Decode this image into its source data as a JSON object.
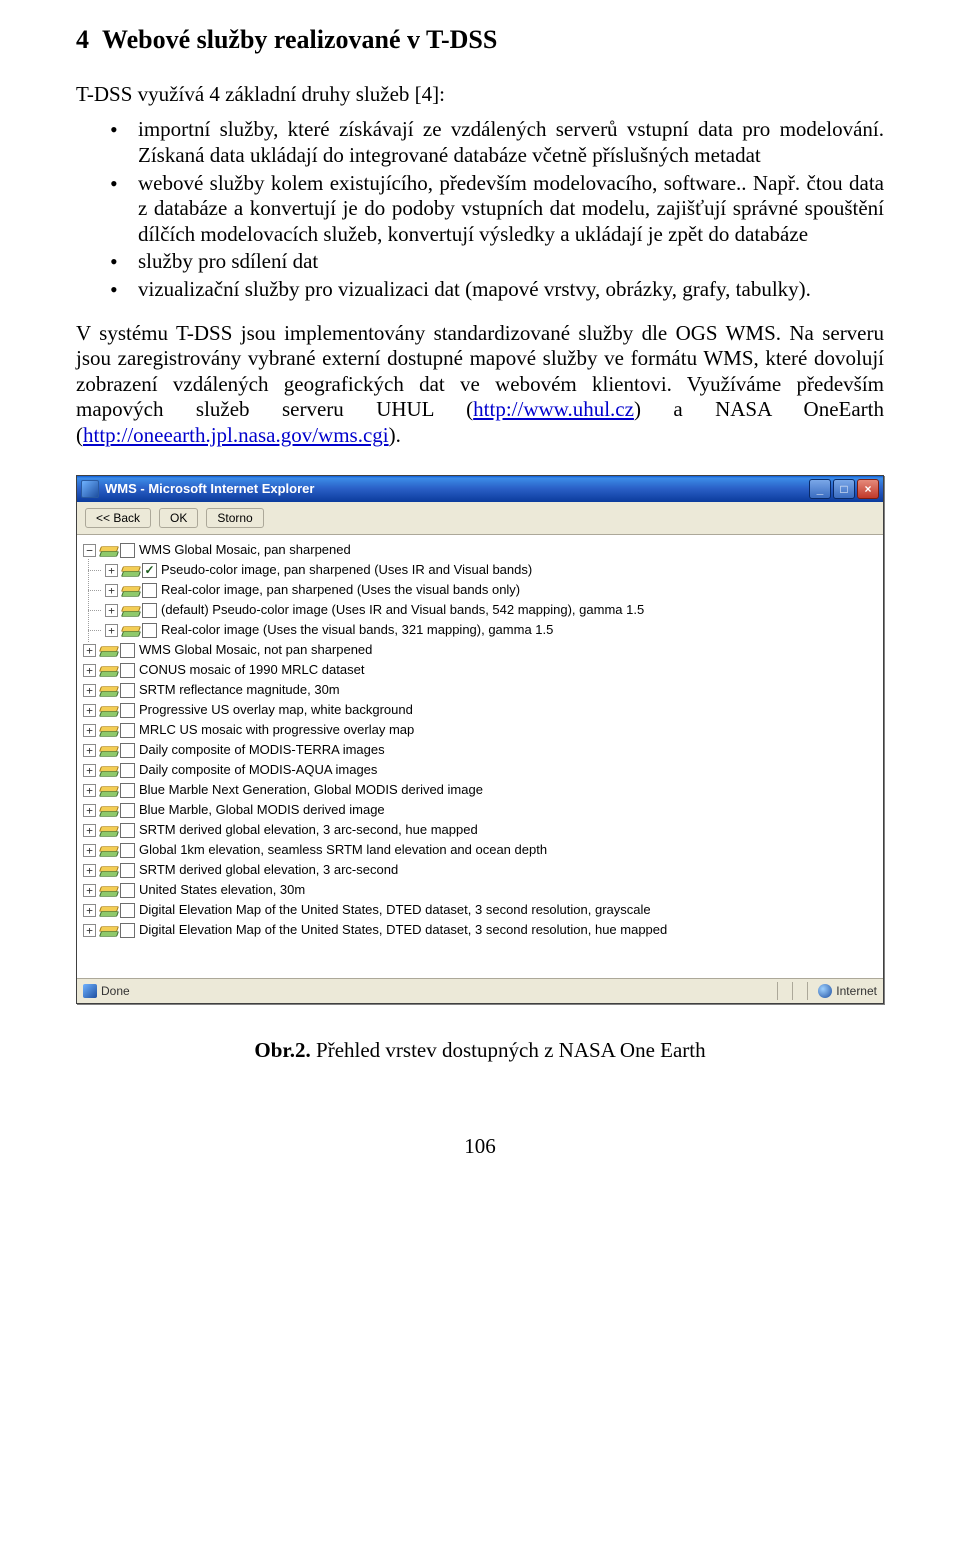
{
  "section": {
    "number": "4",
    "title": "Webové služby realizované v T-DSS"
  },
  "intro": "T-DSS využívá 4 základní druhy služeb [4]:",
  "bullets": [
    "importní služby, které získávají ze vzdálených serverů vstupní data pro modelování. Získaná data ukládají do integrované databáze včetně příslušných metadat",
    "webové služby kolem existujícího, především modelovacího, software.. Např. čtou data z databáze a konvertují je do podoby vstupních dat modelu, zajišťují správné spouštění dílčích modelovacích služeb, konvertují výsledky a ukládají je zpět do databáze",
    "služby pro sdílení dat",
    "vizualizační služby pro vizualizaci dat (mapové vrstvy, obrázky, grafy, tabulky)."
  ],
  "para_parts": {
    "a": "V systému T-DSS jsou implementovány standardizované služby dle OGS WMS. Na serveru jsou zaregistrovány vybrané externí dostupné mapové služby ve formátu WMS, které dovolují zobrazení vzdálených geografických dat ve webovém klientovi. Využíváme především mapových služeb serveru UHUL (",
    "link1": "http://www.uhul.cz",
    "b": ") a NASA OneEarth (",
    "link2": "http://oneearth.jpl.nasa.gov/wms.cgi",
    "c": ")."
  },
  "window": {
    "title": "WMS - Microsoft Internet Explorer",
    "btn_back": "<< Back",
    "btn_ok": "OK",
    "btn_storno": "Storno",
    "status_done": "Done",
    "status_zone": "Internet"
  },
  "tree_top": [
    {
      "checked": false,
      "label": "WMS Global Mosaic, pan sharpened"
    }
  ],
  "tree_children": [
    {
      "checked": true,
      "label": "Pseudo-color image, pan sharpened (Uses IR and Visual bands)"
    },
    {
      "checked": false,
      "label": "Real-color image, pan sharpened (Uses the visual bands only)"
    },
    {
      "checked": false,
      "label": "(default) Pseudo-color image (Uses IR and Visual bands, 542 mapping), gamma 1.5"
    },
    {
      "checked": false,
      "label": "Real-color image (Uses the visual bands, 321 mapping), gamma 1.5"
    }
  ],
  "tree_rest": [
    {
      "label": "WMS Global Mosaic, not pan sharpened"
    },
    {
      "label": "CONUS mosaic of 1990 MRLC dataset"
    },
    {
      "label": "SRTM reflectance magnitude, 30m"
    },
    {
      "label": "Progressive US overlay map, white background"
    },
    {
      "label": "MRLC US mosaic with progressive overlay map"
    },
    {
      "label": "Daily composite of MODIS-TERRA images"
    },
    {
      "label": "Daily composite of MODIS-AQUA images"
    },
    {
      "label": "Blue Marble Next Generation, Global MODIS derived image"
    },
    {
      "label": "Blue Marble, Global MODIS derived image"
    },
    {
      "label": "SRTM derived global elevation, 3 arc-second, hue mapped"
    },
    {
      "label": "Global 1km elevation, seamless SRTM land elevation and ocean depth"
    },
    {
      "label": "SRTM derived global elevation, 3 arc-second"
    },
    {
      "label": "United States elevation, 30m"
    },
    {
      "label": "Digital Elevation Map of the United States, DTED dataset, 3 second resolution, grayscale"
    },
    {
      "label": "Digital Elevation Map of the United States, DTED dataset, 3 second resolution, hue mapped"
    }
  ],
  "caption": {
    "label": "Obr.2.",
    "text": " Přehled vrstev dostupných z NASA One Earth"
  },
  "page_number": "106"
}
